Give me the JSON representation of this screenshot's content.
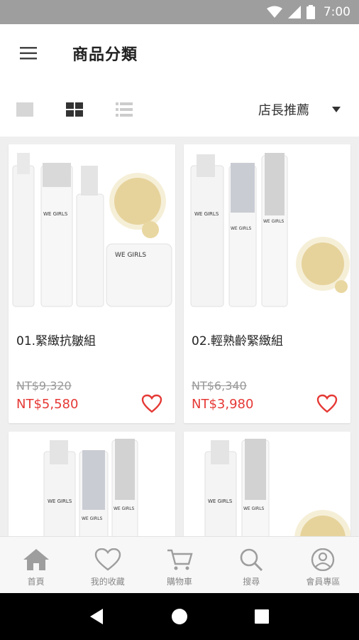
{
  "status_bar": {
    "time": "7:00",
    "icons": [
      "wifi-icon",
      "signal-icon",
      "battery-icon"
    ]
  },
  "app_bar": {
    "title": "商品分類",
    "menu_icon": "hamburger-menu-icon"
  },
  "toolbar": {
    "views": [
      {
        "name": "single-view-icon",
        "selected": false
      },
      {
        "name": "grid-view-icon",
        "selected": true
      },
      {
        "name": "list-view-icon",
        "selected": false
      }
    ],
    "sort": {
      "selected": "店長推薦",
      "icon": "dropdown-arrow-icon"
    }
  },
  "products": [
    {
      "name": "01.緊緻抗皺組",
      "original_price": "NT$9,320",
      "sale_price": "NT$5,580"
    },
    {
      "name": "02.輕熟齡緊緻組",
      "original_price": "NT$6,340",
      "sale_price": "NT$3,980"
    },
    {
      "name": "",
      "original_price": "",
      "sale_price": ""
    },
    {
      "name": "",
      "original_price": "",
      "sale_price": ""
    }
  ],
  "brand_text": "WE GIRLS",
  "bottom_nav": [
    {
      "label": "首頁",
      "icon": "home-icon"
    },
    {
      "label": "我的收藏",
      "icon": "heart-icon"
    },
    {
      "label": "購物車",
      "icon": "cart-icon"
    },
    {
      "label": "搜尋",
      "icon": "search-icon"
    },
    {
      "label": "會員專區",
      "icon": "user-icon"
    }
  ],
  "colors": {
    "accent": "#e53935",
    "status_bar": "#9e9e9e",
    "nav_icon": "#9e9e9e"
  }
}
